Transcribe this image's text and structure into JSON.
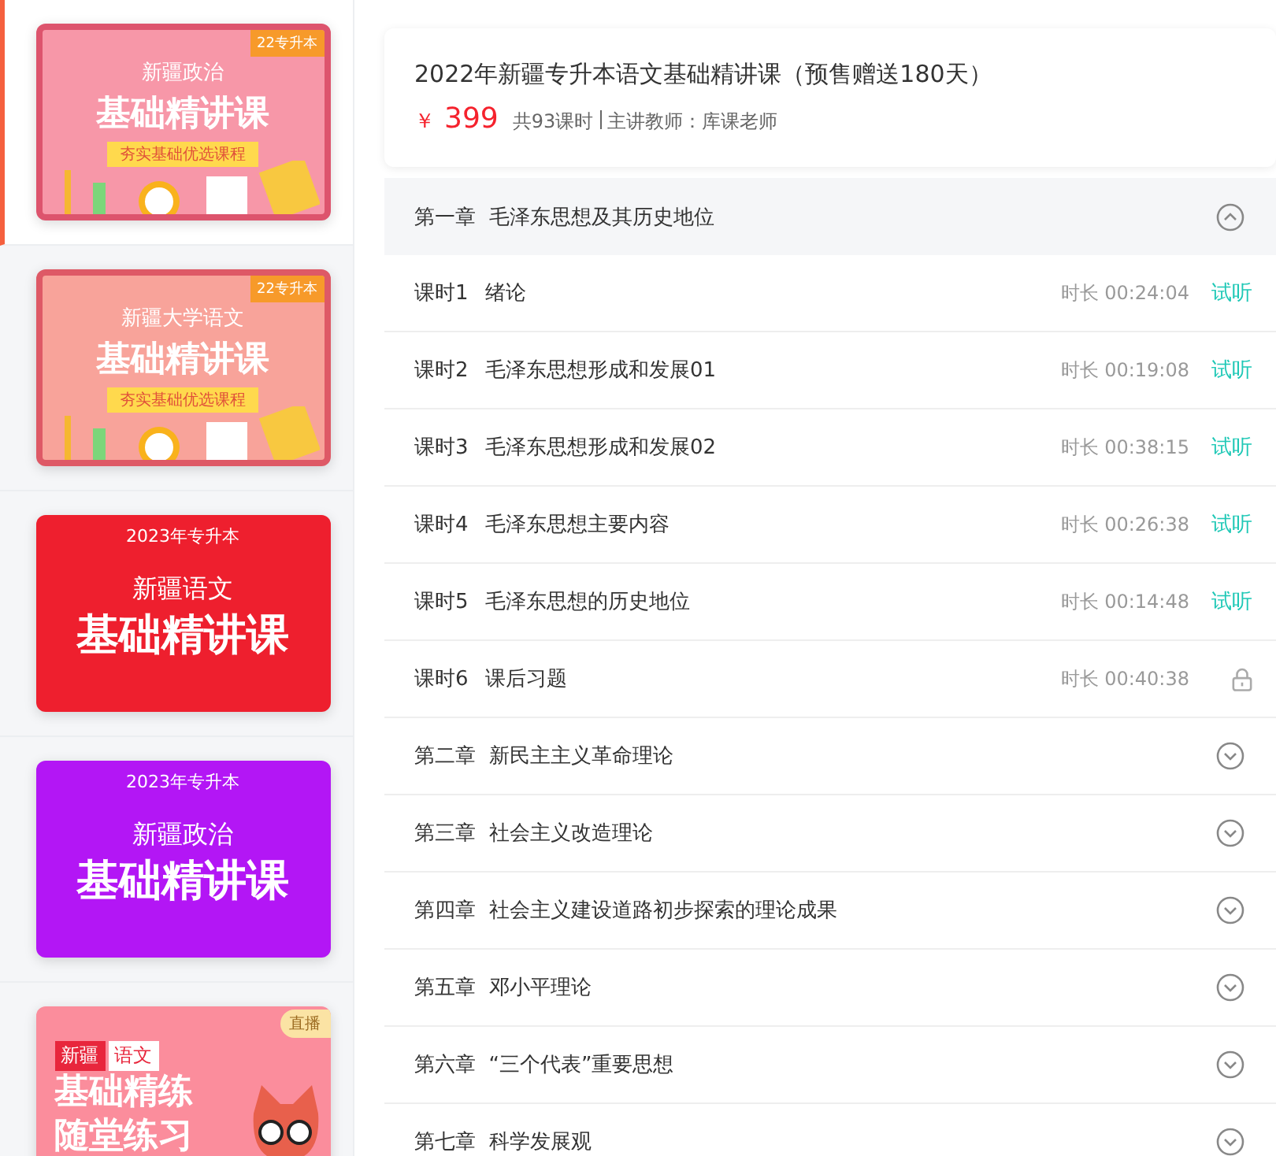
{
  "sidebar": {
    "items": [
      {
        "selected": true,
        "cover": {
          "kind": "classic",
          "color": "#f797a8",
          "tag": "22专升本",
          "subject": "新疆政治",
          "title": "基础精讲课",
          "slogan": "夯实基础优选课程"
        }
      },
      {
        "selected": false,
        "cover": {
          "kind": "classic",
          "color": "#f8a39a",
          "tag": "22专升本",
          "subject": "新疆大学语文",
          "title": "基础精讲课",
          "slogan": "夯实基础优选课程"
        }
      },
      {
        "selected": false,
        "cover": {
          "kind": "gradient",
          "color": "#ee1f2e",
          "tag": "2023年专升本",
          "subject": "新疆语文",
          "title": "基础精讲课"
        }
      },
      {
        "selected": false,
        "cover": {
          "kind": "gradient",
          "color": "#b316f5",
          "tag": "2023年专升本",
          "subject": "新疆政治",
          "title": "基础精讲课"
        }
      },
      {
        "selected": false,
        "cover": {
          "kind": "live",
          "color": "#fb8d9c",
          "tag": "直播",
          "region": "新疆",
          "subject": "语文",
          "title": "基础精练",
          "subtitle": "随堂练习"
        }
      }
    ]
  },
  "course": {
    "title": "2022年新疆专升本语文基础精讲课（预售赠送180天）",
    "currency": "￥",
    "price": "399",
    "lessons": "共93课时",
    "teacher": "主讲教师：库课老师"
  },
  "chapters": [
    {
      "title": "第一章  毛泽东思想及其历史地位",
      "expanded": true,
      "lessons": [
        {
          "index": "课时1",
          "title": "绪论",
          "duration": "时长 00:24:04",
          "kind": "trial",
          "trial": "试听"
        },
        {
          "index": "课时2",
          "title": "毛泽东思想形成和发展01",
          "duration": "时长 00:19:08",
          "kind": "trial",
          "trial": "试听"
        },
        {
          "index": "课时3",
          "title": "毛泽东思想形成和发展02",
          "duration": "时长 00:38:15",
          "kind": "trial",
          "trial": "试听"
        },
        {
          "index": "课时4",
          "title": "毛泽东思想主要内容",
          "duration": "时长 00:26:38",
          "kind": "trial",
          "trial": "试听"
        },
        {
          "index": "课时5",
          "title": "毛泽东思想的历史地位",
          "duration": "时长 00:14:48",
          "kind": "trial",
          "trial": "试听"
        },
        {
          "index": "课时6",
          "title": "课后习题",
          "duration": "时长 00:40:38",
          "kind": "locked"
        }
      ]
    },
    {
      "title": "第二章  新民主主义革命理论",
      "expanded": false
    },
    {
      "title": "第三章  社会主义改造理论",
      "expanded": false
    },
    {
      "title": "第四章  社会主义建设道路初步探索的理论成果",
      "expanded": false
    },
    {
      "title": "第五章  邓小平理论",
      "expanded": false
    },
    {
      "title": "第六章  “三个代表”重要思想",
      "expanded": false
    },
    {
      "title": "第七章  科学发展观",
      "expanded": false
    }
  ]
}
